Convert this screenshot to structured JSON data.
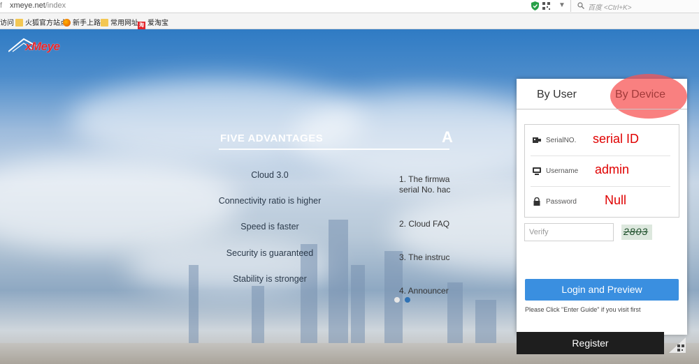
{
  "browser": {
    "address_prefix": "f",
    "url_host": "xmeye.net",
    "url_path": "/index",
    "search_placeholder": "百度 <Ctrl+K>"
  },
  "bookmarks": [
    {
      "label": "访问",
      "icon": "none"
    },
    {
      "label": "火狐官方站点",
      "icon": "folder-icon"
    },
    {
      "label": "新手上路",
      "icon": "firefox-icon"
    },
    {
      "label": "常用网址",
      "icon": "folder-icon"
    },
    {
      "label": "爱淘宝",
      "icon": "taobao-icon"
    }
  ],
  "logo": {
    "text": "xMeye"
  },
  "advantages": {
    "title": "FIVE ADVANTAGES",
    "items": [
      "Cloud 3.0",
      "Connectivity ratio is higher",
      "Speed is faster",
      "Security is guaranteed",
      "Stability is stronger"
    ]
  },
  "announcements": {
    "title": "A",
    "items": [
      "1. The firmwa",
      "serial No. hac",
      "2. Cloud FAQ",
      "3. The instruc",
      "4. Announcer"
    ]
  },
  "login": {
    "tabs": [
      "By User",
      "By Device"
    ],
    "active_tab": "By Device",
    "fields": [
      {
        "label": "SerialNO.",
        "value": "serial ID",
        "icon": "serial-icon"
      },
      {
        "label": "Username",
        "value": "admin",
        "icon": "user-icon"
      },
      {
        "label": "Password",
        "value": "Null",
        "icon": "lock-icon"
      }
    ],
    "verify_placeholder": "Verify",
    "captcha": "2803",
    "login_button": "Login and Preview",
    "hint": "Please Click \"Enter Guide\" if you visit first",
    "register_button": "Register"
  },
  "colors": {
    "accent": "#3a8fe0",
    "highlight": "#f75656",
    "annotation": "#e00000",
    "logo": "#e8262b"
  }
}
